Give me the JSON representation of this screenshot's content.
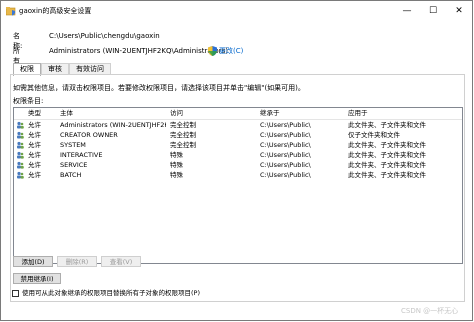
{
  "window": {
    "title": "gaoxin的高级安全设置",
    "minimize_glyph": "—",
    "maximize_glyph": "☐",
    "close_glyph": "✕"
  },
  "info": {
    "name_label": "名称:",
    "name_value": "C:\\Users\\Public\\chengdu\\gaoxin",
    "owner_label": "所有者:",
    "owner_value": "Administrators (WIN-2UENTJHF2KQ\\Administrators)",
    "change_link": "更改(C)"
  },
  "tabs": [
    {
      "label": "权限",
      "active": true
    },
    {
      "label": "审核",
      "active": false
    },
    {
      "label": "有效访问",
      "active": false
    }
  ],
  "instruction": "如需其他信息，请双击权限项目。若要修改权限项目，请选择该项目并单击\"编辑\"(如果可用)。",
  "entries_label": "权限条目:",
  "table": {
    "headers": [
      "类型",
      "主体",
      "访问",
      "继承于",
      "应用于"
    ],
    "rows": [
      {
        "type": "允许",
        "principal": "Administrators (WIN-2UENTJHF2K...",
        "access": "完全控制",
        "inherited": "C:\\Users\\Public\\",
        "applies": "此文件夹、子文件夹和文件"
      },
      {
        "type": "允许",
        "principal": "CREATOR OWNER",
        "access": "完全控制",
        "inherited": "C:\\Users\\Public\\",
        "applies": "仅子文件夹和文件"
      },
      {
        "type": "允许",
        "principal": "SYSTEM",
        "access": "完全控制",
        "inherited": "C:\\Users\\Public\\",
        "applies": "此文件夹、子文件夹和文件"
      },
      {
        "type": "允许",
        "principal": "INTERACTIVE",
        "access": "特殊",
        "inherited": "C:\\Users\\Public\\",
        "applies": "此文件夹、子文件夹和文件"
      },
      {
        "type": "允许",
        "principal": "SERVICE",
        "access": "特殊",
        "inherited": "C:\\Users\\Public\\",
        "applies": "此文件夹、子文件夹和文件"
      },
      {
        "type": "允许",
        "principal": "BATCH",
        "access": "特殊",
        "inherited": "C:\\Users\\Public\\",
        "applies": "此文件夹、子文件夹和文件"
      }
    ]
  },
  "buttons": {
    "add": "添加(D)",
    "remove": "删除(R)",
    "view": "查看(V)",
    "disable_inheritance": "禁用继承(I)"
  },
  "replace_checkbox_label": "使用可从此对象继承的权限项目替换所有子对象的权限项目(P)",
  "watermark": "CSDN @一杯无心",
  "colors": {
    "link": "#0066cc",
    "disabled_text": "#9a9a9a"
  }
}
